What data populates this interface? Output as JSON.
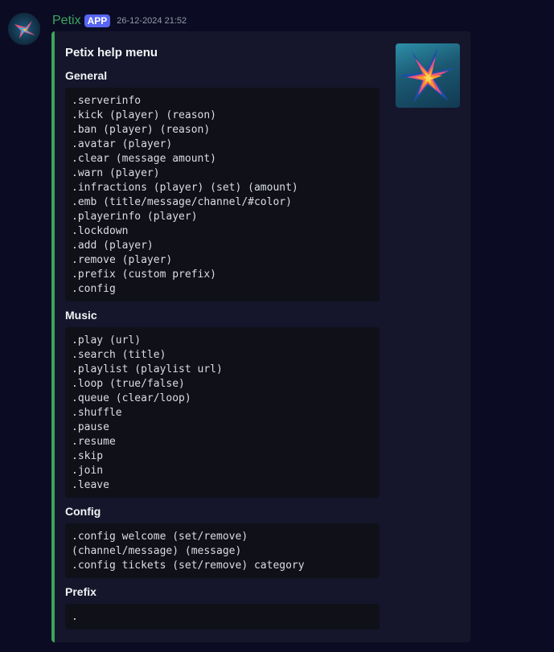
{
  "message": {
    "author": "Petix",
    "badge": "APP",
    "timestamp": "26-12-2024 21:52",
    "accent_color": "#3ba55d",
    "username_color": "#3ba55d",
    "badge_color": "#5865f2",
    "avatar_icon": "star-burst-logo",
    "thumbnail_icon": "star-burst-logo"
  },
  "embed": {
    "title": "Petix help menu",
    "fields": [
      {
        "name": "General",
        "lines": [
          ".serverinfo",
          ".kick (player) (reason)",
          ".ban (player) (reason)",
          ".avatar (player)",
          ".clear (message amount)",
          ".warn (player)",
          ".infractions (player) (set) (amount)",
          ".emb (title/message/channel/#color)",
          ".playerinfo (player)",
          ".lockdown",
          ".add (player)",
          ".remove (player)",
          ".prefix (custom prefix)",
          ".config"
        ]
      },
      {
        "name": "Music",
        "lines": [
          ".play (url)",
          ".search (title)",
          ".playlist (playlist url)",
          ".loop (true/false)",
          ".queue (clear/loop)",
          ".shuffle",
          ".pause",
          ".resume",
          ".skip",
          ".join",
          ".leave"
        ]
      },
      {
        "name": "Config",
        "lines": [
          ".config welcome (set/remove)",
          "(channel/message) (message)",
          ".config tickets (set/remove) category"
        ]
      },
      {
        "name": "Prefix",
        "lines": [
          "."
        ]
      }
    ]
  }
}
